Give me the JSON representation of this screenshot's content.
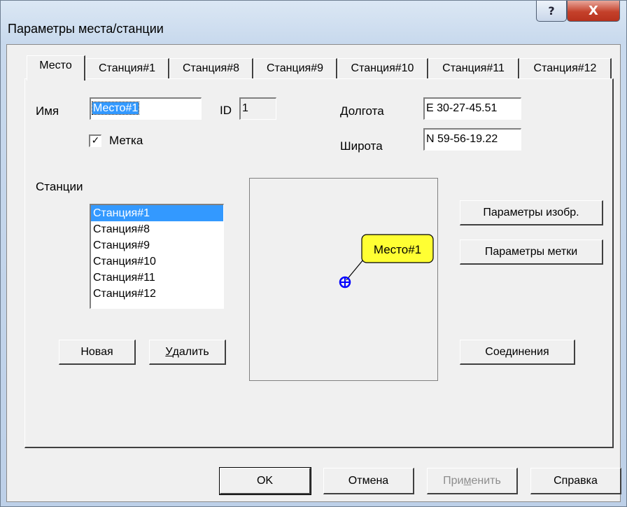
{
  "window": {
    "title": "Параметры места/станции",
    "help_symbol": "?",
    "close_symbol": "X"
  },
  "tabs": [
    {
      "label": "Место",
      "active": true
    },
    {
      "label": "Станция#1"
    },
    {
      "label": "Станция#8"
    },
    {
      "label": "Станция#9"
    },
    {
      "label": "Станция#10"
    },
    {
      "label": "Станция#11"
    },
    {
      "label": "Станция#12"
    }
  ],
  "form": {
    "name_label": "Имя",
    "name_value": "Место#1",
    "id_label": "ID",
    "id_value": "1",
    "mark_label": "Метка",
    "mark_checked": true,
    "mark_check_glyph": "✓",
    "longitude_label": "Долгота",
    "longitude_value": "E 30-27-45.51",
    "latitude_label": "Широта",
    "latitude_value": "N 59-56-19.22"
  },
  "stations": {
    "label": "Станции",
    "items": [
      "Станция#1",
      "Станция#8",
      "Станция#9",
      "Станция#10",
      "Станция#11",
      "Станция#12"
    ],
    "selected": "Станция#1"
  },
  "buttons": {
    "new": "Новая",
    "delete_prefix": "",
    "delete_underlined": "У",
    "delete_rest": "далить",
    "image_params": "Параметры изобр.",
    "mark_params": "Параметры метки",
    "connections": "Соединения",
    "ok": "OK",
    "cancel": "Отмена",
    "apply_prefix": "При",
    "apply_underlined": "м",
    "apply_rest": "енить",
    "help": "Справка"
  },
  "preview": {
    "marker_label": "Место#1",
    "marker_color": "#0000ff",
    "label_bg": "#ffff33"
  }
}
